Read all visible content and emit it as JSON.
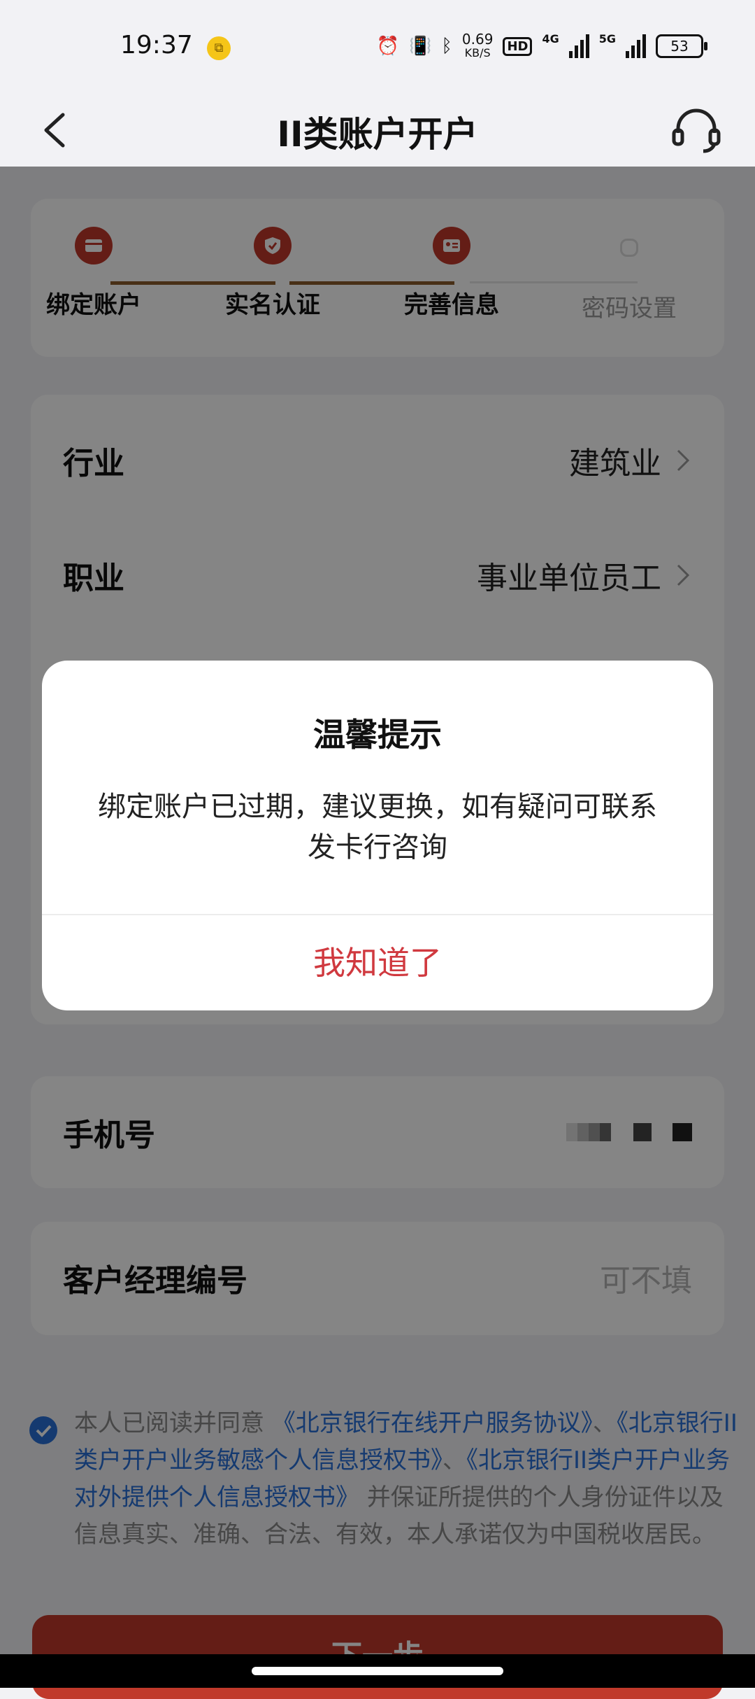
{
  "status_bar": {
    "time": "19:37",
    "net_speed_value": "0.69",
    "net_speed_unit": "KB/S",
    "hd_label": "HD",
    "net1": "4G",
    "net2": "5G",
    "battery": "53",
    "icons": [
      "app-notification-icon",
      "alarm-icon",
      "vibrate-icon",
      "bluetooth-icon",
      "hd-voice-icon",
      "signal-4g-icon",
      "signal-5g-icon",
      "battery-icon"
    ]
  },
  "nav": {
    "title": "II类账户开户",
    "back_icon": "chevron-left-icon",
    "service_icon": "headset-icon"
  },
  "steps": [
    {
      "label": "绑定账户",
      "state": "done",
      "icon": "card-icon"
    },
    {
      "label": "实名认证",
      "state": "done",
      "icon": "shield-icon"
    },
    {
      "label": "完善信息",
      "state": "current",
      "icon": "id-card-icon"
    },
    {
      "label": "密码设置",
      "state": "todo",
      "icon": ""
    }
  ],
  "form": {
    "industry_label": "行业",
    "industry_value": "建筑业",
    "occupation_label": "职业",
    "occupation_value": "事业单位员工",
    "phone_label": "手机号",
    "manager_label": "客户经理编号",
    "manager_placeholder": "可不填"
  },
  "agreement": {
    "prefix": "本人已阅读并同意",
    "link1": "《北京银行在线开户服务协议》",
    "sep1": "、",
    "link2": "《北京银行II类户开户业务敏感个人信息授权书》",
    "sep2": "、",
    "link3": "《北京银行II类户开户业务对外提供个人信息授权书》",
    "suffix": "并保证所提供的个人身份证件以及信息真实、准确、合法、有效，本人承诺仅为中国税收居民。",
    "checked": true
  },
  "next_button": "下一步",
  "dialog": {
    "title": "温馨提示",
    "message": "绑定账户已过期，建议更换，如有疑问可联系发卡行咨询",
    "confirm": "我知道了"
  },
  "colors": {
    "brand_red": "#c0392b",
    "link_blue": "#2a6fd6",
    "dialog_button": "#d0393f"
  }
}
